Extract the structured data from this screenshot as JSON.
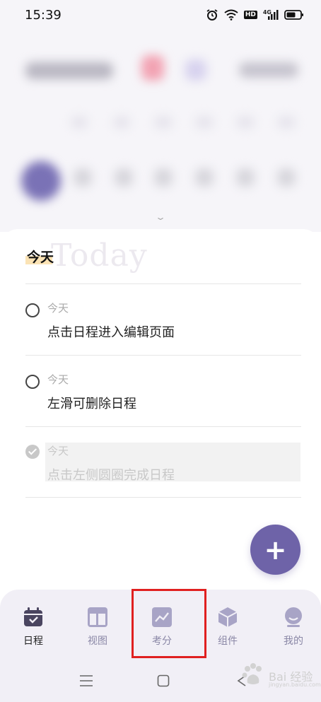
{
  "status_bar": {
    "time": "15:39",
    "icons": [
      "alarm-icon",
      "wifi-icon",
      "hd-icon",
      "signal-4g-icon",
      "battery-icon"
    ],
    "hd_label": "HD",
    "network_label": "4G"
  },
  "today_section": {
    "label": "今天",
    "background_text": "Today"
  },
  "tasks": [
    {
      "date": "今天",
      "title": "点击日程进入编辑页面",
      "done": false
    },
    {
      "date": "今天",
      "title": "左滑可删除日程",
      "done": false
    },
    {
      "date": "今天",
      "title": "点击左侧圆圈完成日程",
      "done": true
    }
  ],
  "fab": {
    "label": "+"
  },
  "tabs": [
    {
      "label": "日程",
      "icon": "calendar-icon",
      "active": true
    },
    {
      "label": "视图",
      "icon": "layout-icon",
      "active": false
    },
    {
      "label": "考分",
      "icon": "chart-icon",
      "active": false
    },
    {
      "label": "组件",
      "icon": "cube-icon",
      "active": false
    },
    {
      "label": "我的",
      "icon": "profile-icon",
      "active": false
    }
  ],
  "colors": {
    "accent": "#6e63a8",
    "tab_inactive": "#8a87a6",
    "highlight": "#e02020",
    "today_mark": "#fbe3b5"
  },
  "watermark": {
    "text": "Bai 经验",
    "sub": "jingyan.baidu.com"
  }
}
